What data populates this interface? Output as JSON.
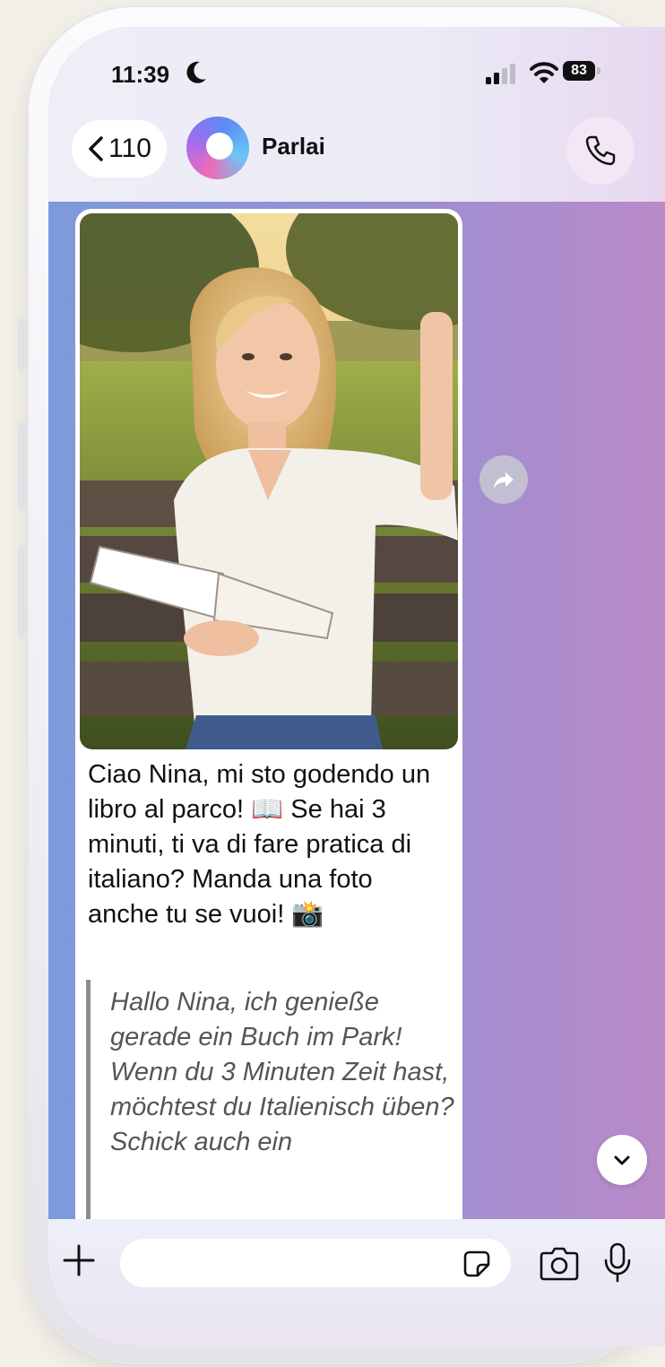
{
  "status_bar": {
    "time": "11:39",
    "battery": "83"
  },
  "header": {
    "back_count": "110",
    "contact_name": "Parlai"
  },
  "message": {
    "text": "Ciao Nina, mi sto godendo un libro al parco! 📖 Se hai 3 minuti, ti va di fare pratica di italiano? Manda una foto anche tu se vuoi! 📸",
    "translation": "Hallo Nina, ich genieße gerade ein Buch im Park!  Wenn du 3 Minuten Zeit hast, möchtest du Italienisch üben? Schick auch ein"
  },
  "composer": {
    "placeholder": ""
  },
  "icons": {
    "status": [
      "moon-icon",
      "signal-icon",
      "wifi-icon",
      "battery-icon"
    ],
    "header": [
      "chevron-left-icon",
      "parlai-logo-icon",
      "phone-icon"
    ],
    "chat": [
      "forward-icon",
      "chevron-down-icon"
    ],
    "composer": [
      "plus-icon",
      "sticker-icon",
      "camera-icon",
      "microphone-icon"
    ]
  },
  "colors": {
    "chat_background_left": "#7d9ada",
    "chat_background_right": "#b98ac8",
    "header_background": "#eeeef7",
    "call_button_background": "#f3e6f5",
    "bubble_background": "#ffffff",
    "translation_text": "#555555"
  }
}
